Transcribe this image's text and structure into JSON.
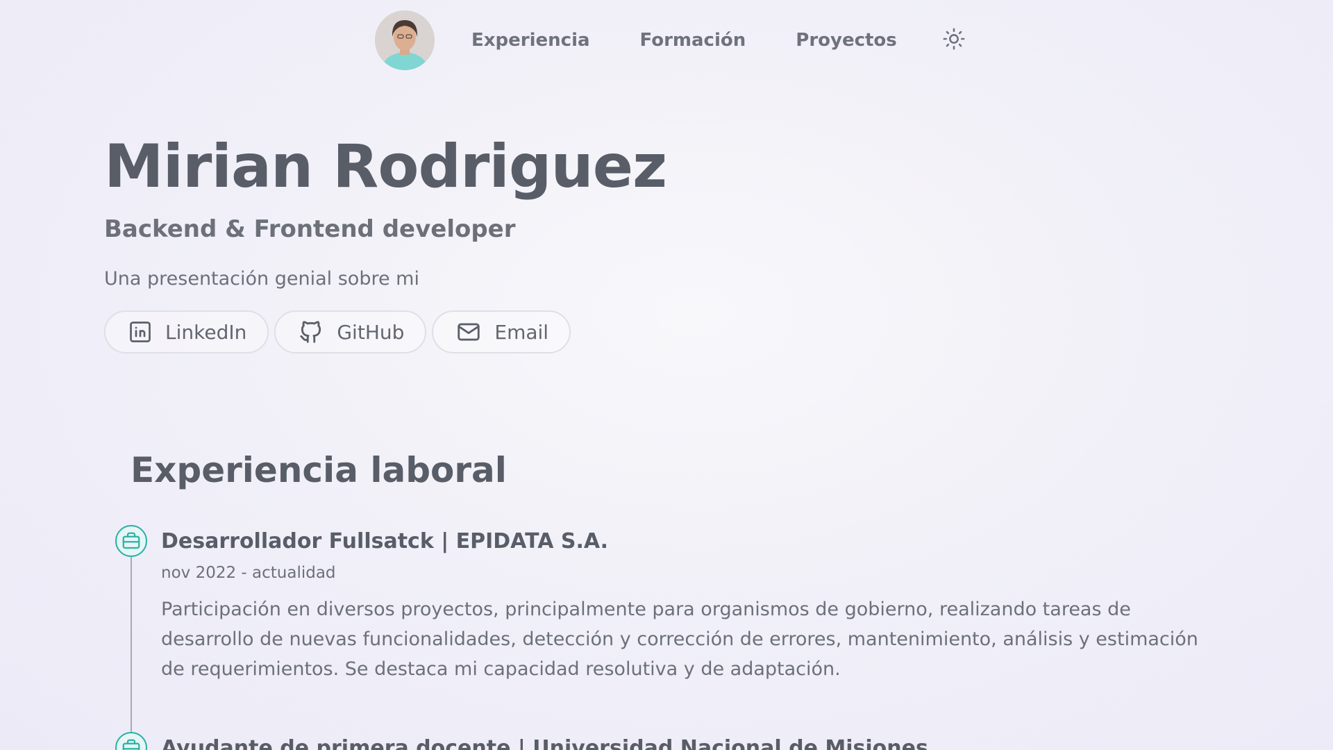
{
  "nav": {
    "avatar_alt": "Mirian Rodriguez",
    "links": [
      "Experiencia",
      "Formación",
      "Proyectos"
    ],
    "theme_icon": "sun-icon"
  },
  "hero": {
    "name": "Mirian Rodriguez",
    "role": "Backend & Frontend developer",
    "intro": "Una presentación genial sobre mi",
    "social": [
      {
        "label": "LinkedIn",
        "icon": "linkedin-icon"
      },
      {
        "label": "GitHub",
        "icon": "github-icon"
      },
      {
        "label": "Email",
        "icon": "mail-icon"
      }
    ]
  },
  "experience": {
    "title": "Experiencia laboral",
    "accent_color": "#2bb1a9",
    "items": [
      {
        "title": "Desarrollador Fullsatck | EPIDATA S.A.",
        "date": "nov 2022 - actualidad",
        "description": "Participación en diversos proyectos, principalmente para organismos de gobierno, realizando tareas de desarrollo de nuevas funcionalidades, detección y corrección de errores, mantenimiento, análisis y estimación de requerimientos. Se destaca mi capacidad resolutiva y de adaptación.",
        "icon": "briefcase-icon"
      },
      {
        "title": "Ayudante de primera docente | Universidad Nacional de Misiones",
        "icon": "briefcase-icon"
      }
    ]
  }
}
